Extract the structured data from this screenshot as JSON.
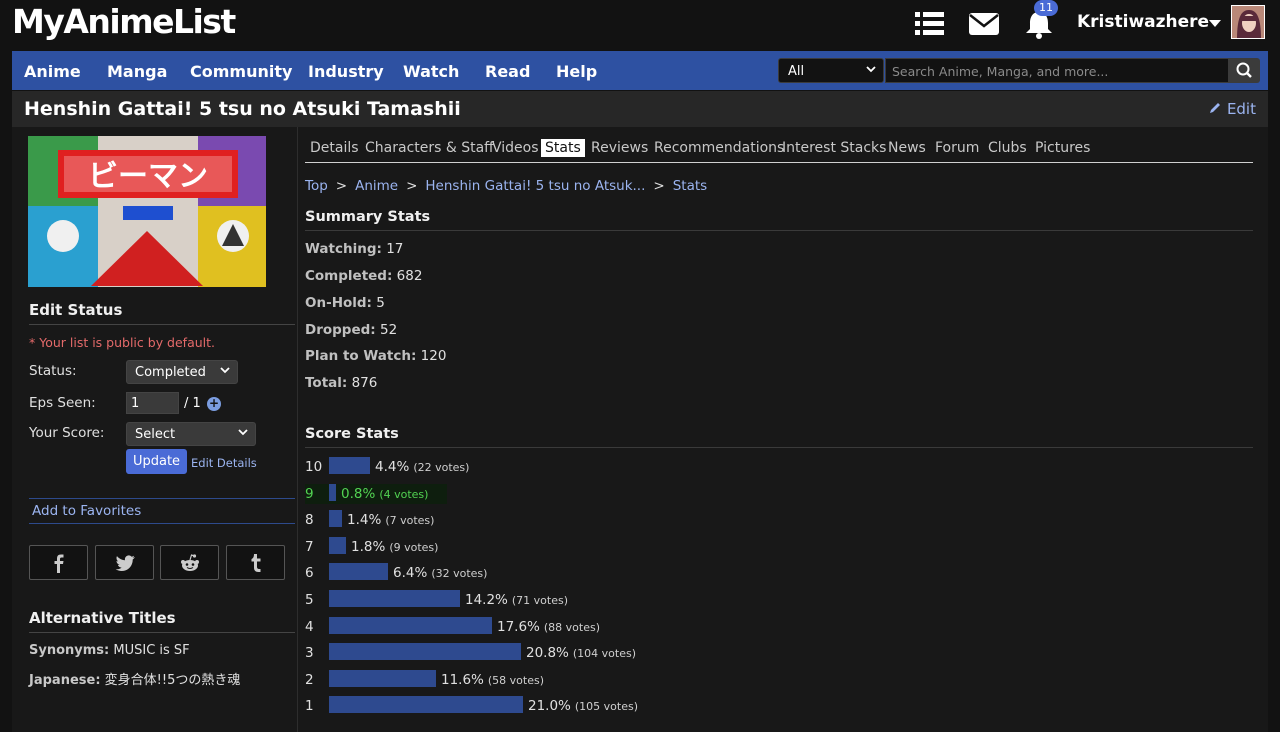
{
  "topbar": {
    "logo": "MyAnimeList",
    "notification_count": "11",
    "username": "Kristiwazhere"
  },
  "nav": {
    "items": [
      "Anime",
      "Manga",
      "Community",
      "Industry",
      "Watch",
      "Read",
      "Help"
    ],
    "search_category": "All",
    "search_placeholder": "Search Anime, Manga, and more..."
  },
  "header": {
    "title": "Henshin Gattai! 5 tsu no Atsuki Tamashii",
    "edit_label": "Edit"
  },
  "sidebar": {
    "edit_status_heading": "Edit Status",
    "public_note": "* Your list is public by default.",
    "status_label": "Status:",
    "status_value": "Completed",
    "eps_label": "Eps Seen:",
    "eps_value": "1",
    "eps_total": "/ 1",
    "score_label": "Your Score:",
    "score_value": "Select",
    "update_label": "Update",
    "edit_details_label": "Edit Details",
    "favorites_label": "Add to Favorites",
    "alt_titles_heading": "Alternative Titles",
    "synonyms_label": "Synonyms:",
    "synonyms_value": "MUSIC is SF",
    "japanese_label": "Japanese:",
    "japanese_value": "変身合体!!5つの熱き魂"
  },
  "tabs": [
    "Details",
    "Characters & Staff",
    "Videos",
    "Stats",
    "Reviews",
    "Recommendations",
    "Interest Stacks",
    "News",
    "Forum",
    "Clubs",
    "Pictures"
  ],
  "active_tab": "Stats",
  "breadcrumb": [
    "Top",
    "Anime",
    "Henshin Gattai! 5 tsu no Atsuk...",
    "Stats"
  ],
  "summary": {
    "heading": "Summary Stats",
    "rows": [
      {
        "label": "Watching:",
        "value": "17"
      },
      {
        "label": "Completed:",
        "value": "682"
      },
      {
        "label": "On-Hold:",
        "value": "5"
      },
      {
        "label": "Dropped:",
        "value": "52"
      },
      {
        "label": "Plan to Watch:",
        "value": "120"
      },
      {
        "label": "Total:",
        "value": "876"
      }
    ]
  },
  "score_stats": {
    "heading": "Score Stats",
    "rows": [
      {
        "score": "10",
        "pct": "4.4%",
        "votes": "(22 votes)",
        "fraction": 0.044
      },
      {
        "score": "9",
        "pct": "0.8%",
        "votes": "(4 votes)",
        "fraction": 0.008,
        "highlight": true
      },
      {
        "score": "8",
        "pct": "1.4%",
        "votes": "(7 votes)",
        "fraction": 0.014
      },
      {
        "score": "7",
        "pct": "1.8%",
        "votes": "(9 votes)",
        "fraction": 0.018
      },
      {
        "score": "6",
        "pct": "6.4%",
        "votes": "(32 votes)",
        "fraction": 0.064
      },
      {
        "score": "5",
        "pct": "14.2%",
        "votes": "(71 votes)",
        "fraction": 0.142
      },
      {
        "score": "4",
        "pct": "17.6%",
        "votes": "(88 votes)",
        "fraction": 0.176
      },
      {
        "score": "3",
        "pct": "20.8%",
        "votes": "(104 votes)",
        "fraction": 0.208
      },
      {
        "score": "2",
        "pct": "11.6%",
        "votes": "(58 votes)",
        "fraction": 0.116
      },
      {
        "score": "1",
        "pct": "21.0%",
        "votes": "(105 votes)",
        "fraction": 0.21
      }
    ]
  },
  "colors": {
    "nav_blue": "#2e51a2",
    "bar_blue": "#2e4a8f",
    "link_blue": "#9bb4f0",
    "highlight_green": "#52d352",
    "note_red": "#e46a6a"
  }
}
